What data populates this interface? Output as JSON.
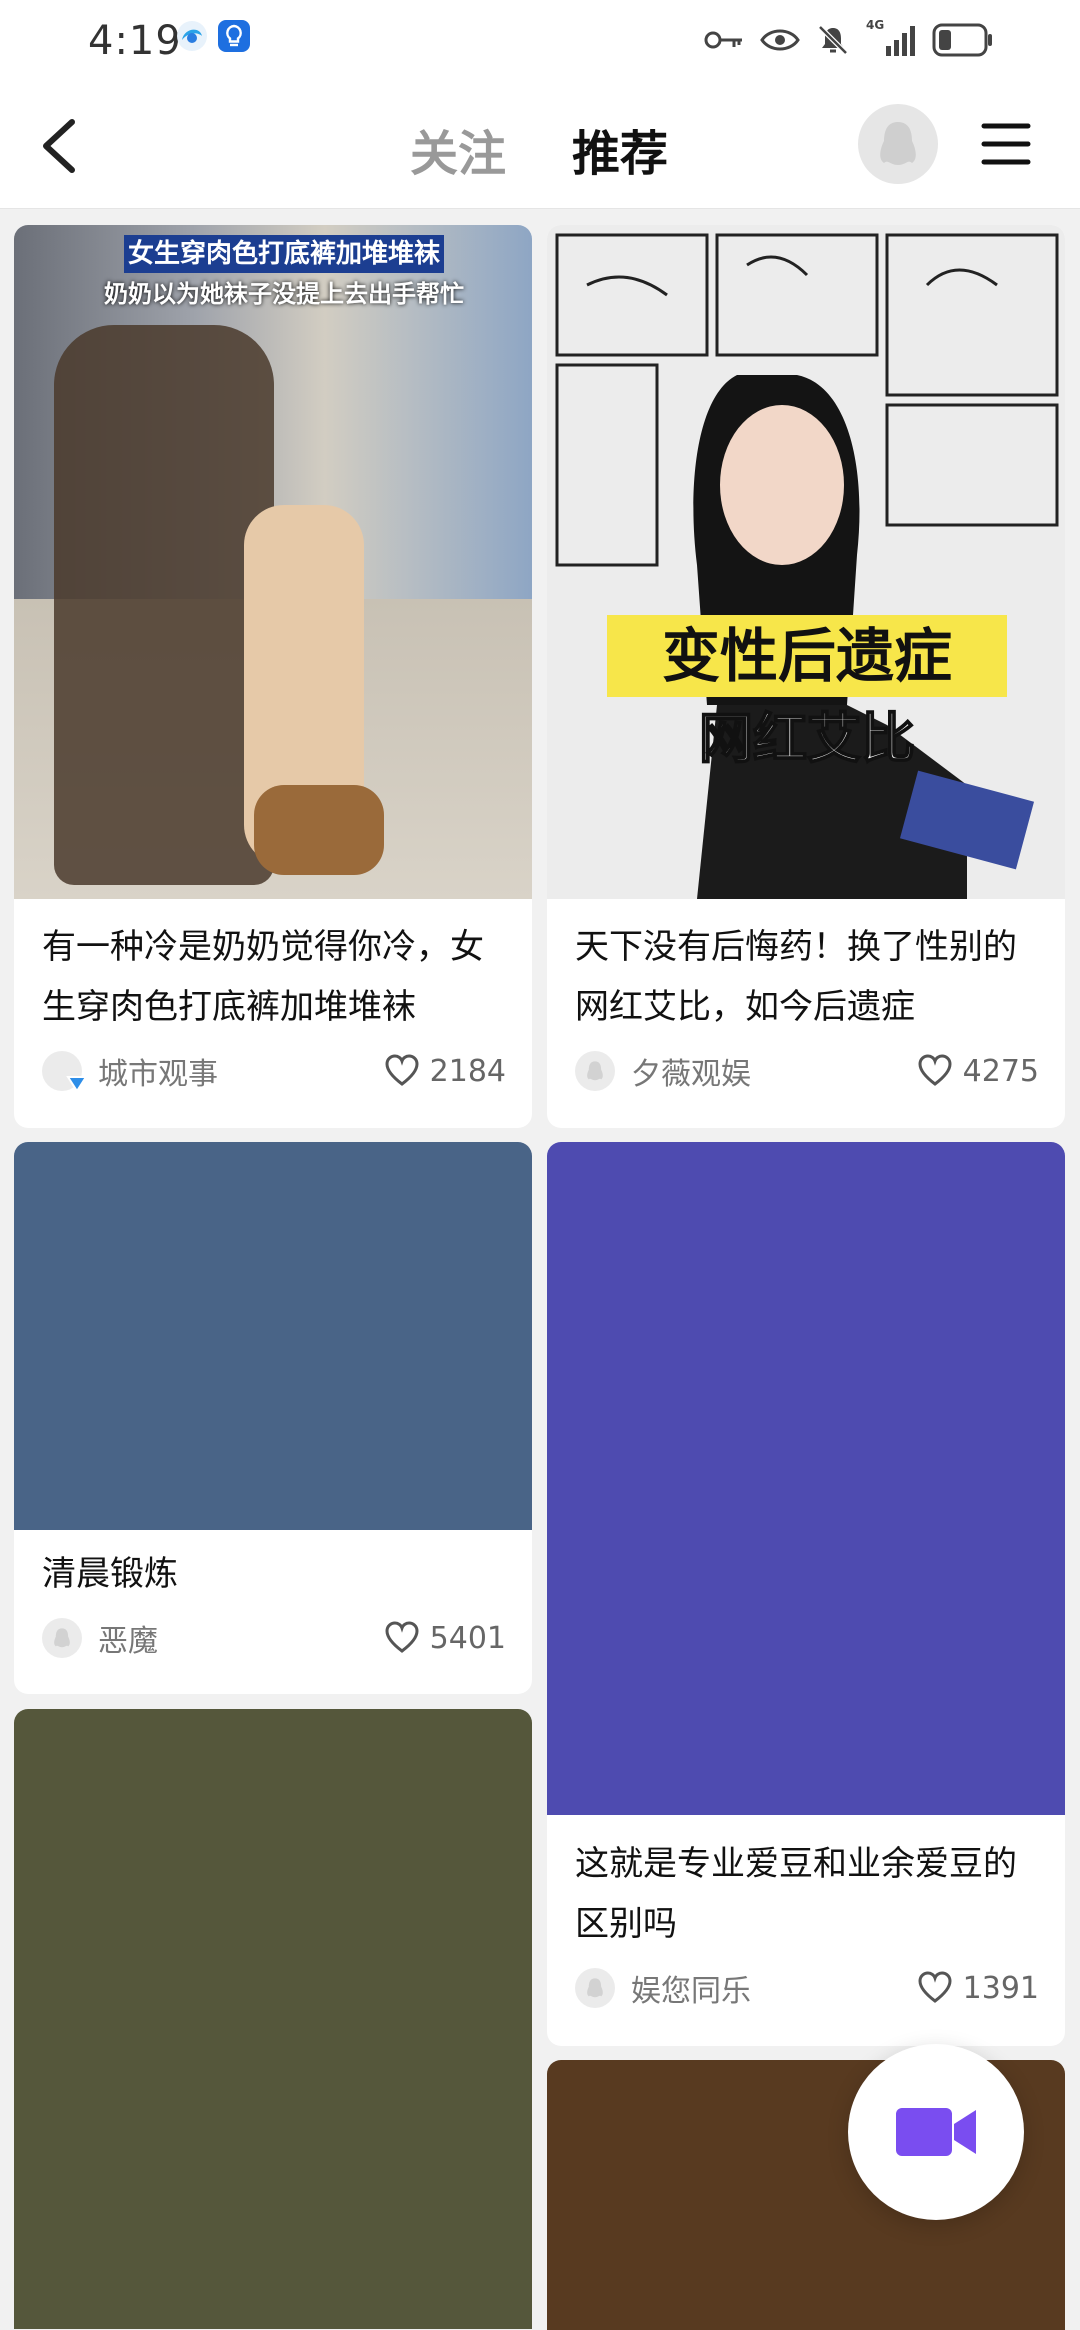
{
  "status_bar": {
    "time": "4:19",
    "network": "4G"
  },
  "header": {
    "tab_follow": "关注",
    "tab_recommend": "推荐"
  },
  "feed": [
    {
      "title": "有一种冷是奶奶觉得你冷，女生穿肉色打底裤加堆堆袜",
      "author": "城市观事",
      "likes": "2184",
      "thumb_caption_1": "女生穿肉色打底裤加堆堆袜",
      "thumb_caption_2": "奶奶以为她袜子没提上去出手帮忙",
      "thumb_colors": [
        "#8d8e93",
        "#c9c3ba"
      ]
    },
    {
      "title": "天下没有后悔药！换了性别的网红艾比，如今后遗症",
      "author": "夕薇观娱",
      "likes": "4275",
      "thumb_caption_1": "变性后遗症",
      "thumb_caption_2": "网红艾比",
      "thumb_colors": [
        "#e9e9e9",
        "#2a2a2a"
      ]
    },
    {
      "title": "清晨锻炼",
      "author": "恶魔",
      "likes": "5401",
      "thumb_color": "#496487"
    },
    {
      "title": "这就是专业爱豆和业余爱豆的区别吗",
      "author": "娱您同乐",
      "likes": "1391",
      "thumb_color": "#4e4bb0"
    },
    {
      "thumb_color": "#55573b"
    },
    {
      "thumb_color": "#583a20"
    }
  ],
  "colors": {
    "accent": "#7a4df0",
    "page_bg": "#f1f1f1"
  },
  "icons": [
    "back-arrow-icon",
    "user-avatar-icon",
    "menu-icon",
    "heart-icon",
    "video-camera-icon",
    "verified-icon"
  ]
}
